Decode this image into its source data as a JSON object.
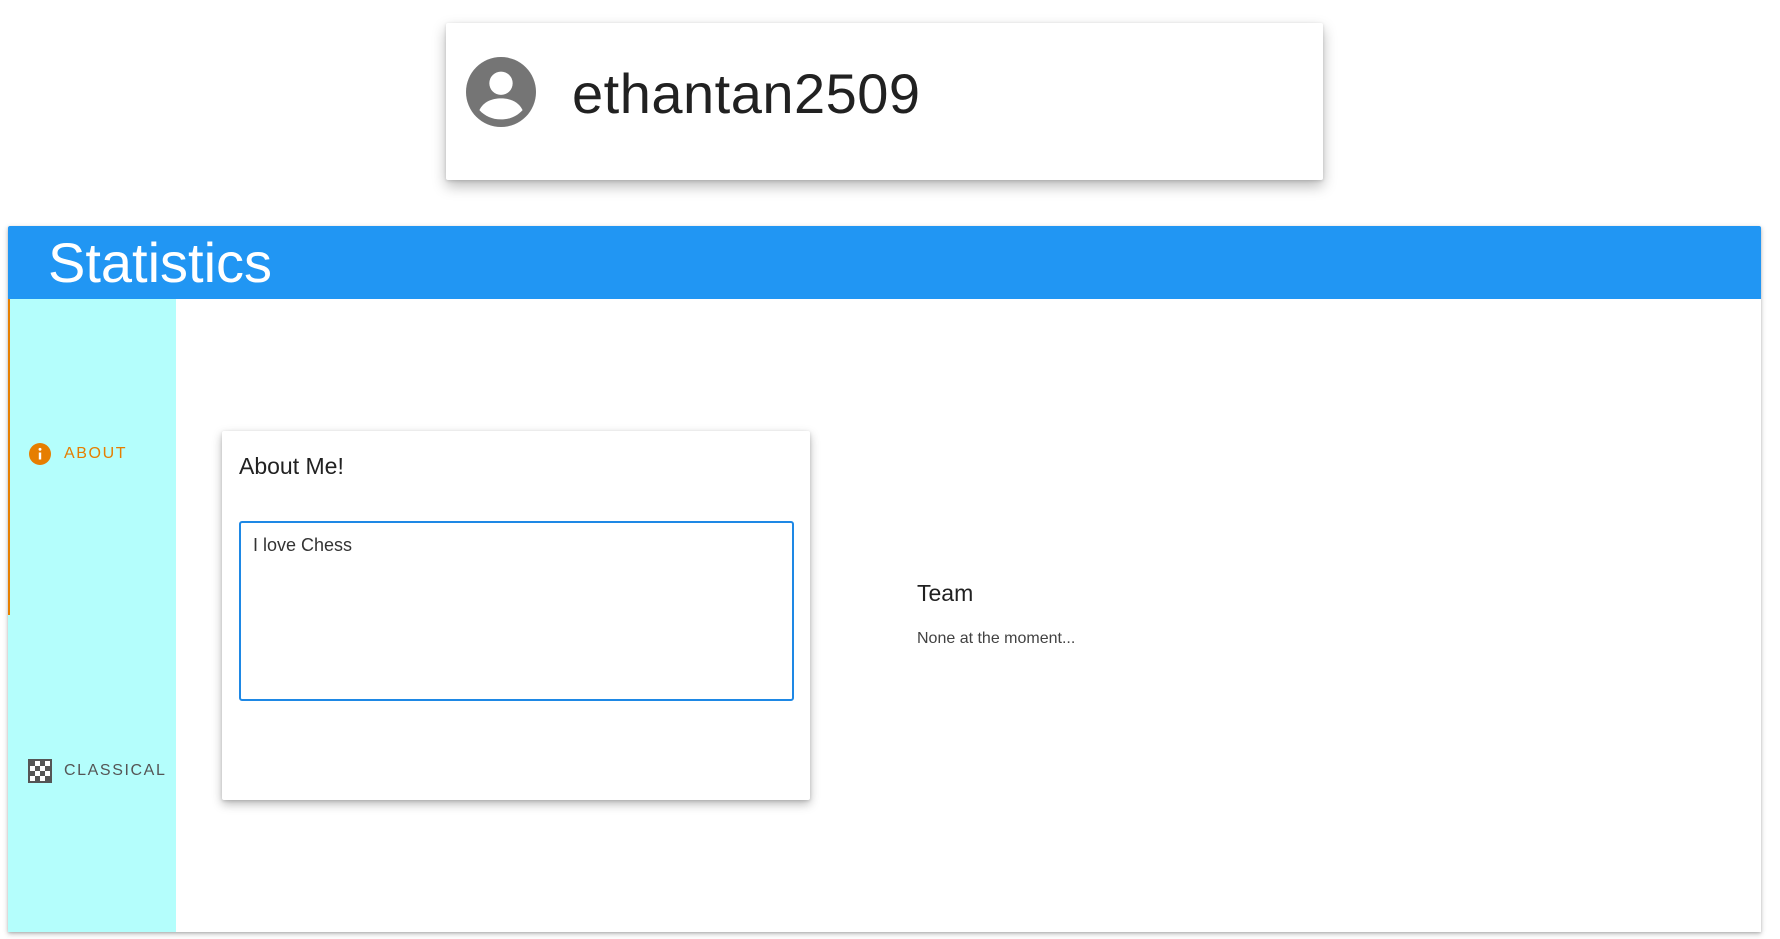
{
  "profile": {
    "username": "ethantan2509",
    "avatar_icon": "account-circle-icon"
  },
  "statistics": {
    "title": "Statistics",
    "header_color": "#2196f3",
    "tabs": [
      {
        "label": "ABOUT",
        "icon": "info-icon",
        "active": true
      },
      {
        "label": "CLASSICAL",
        "icon": "chessboard-icon",
        "active": false
      }
    ],
    "tab_rail_color": "#b4fefc",
    "accent_color": "#e67e00"
  },
  "about": {
    "title": "About Me!",
    "bio": "I love Chess"
  },
  "team": {
    "title": "Team",
    "value": "None at the moment..."
  }
}
